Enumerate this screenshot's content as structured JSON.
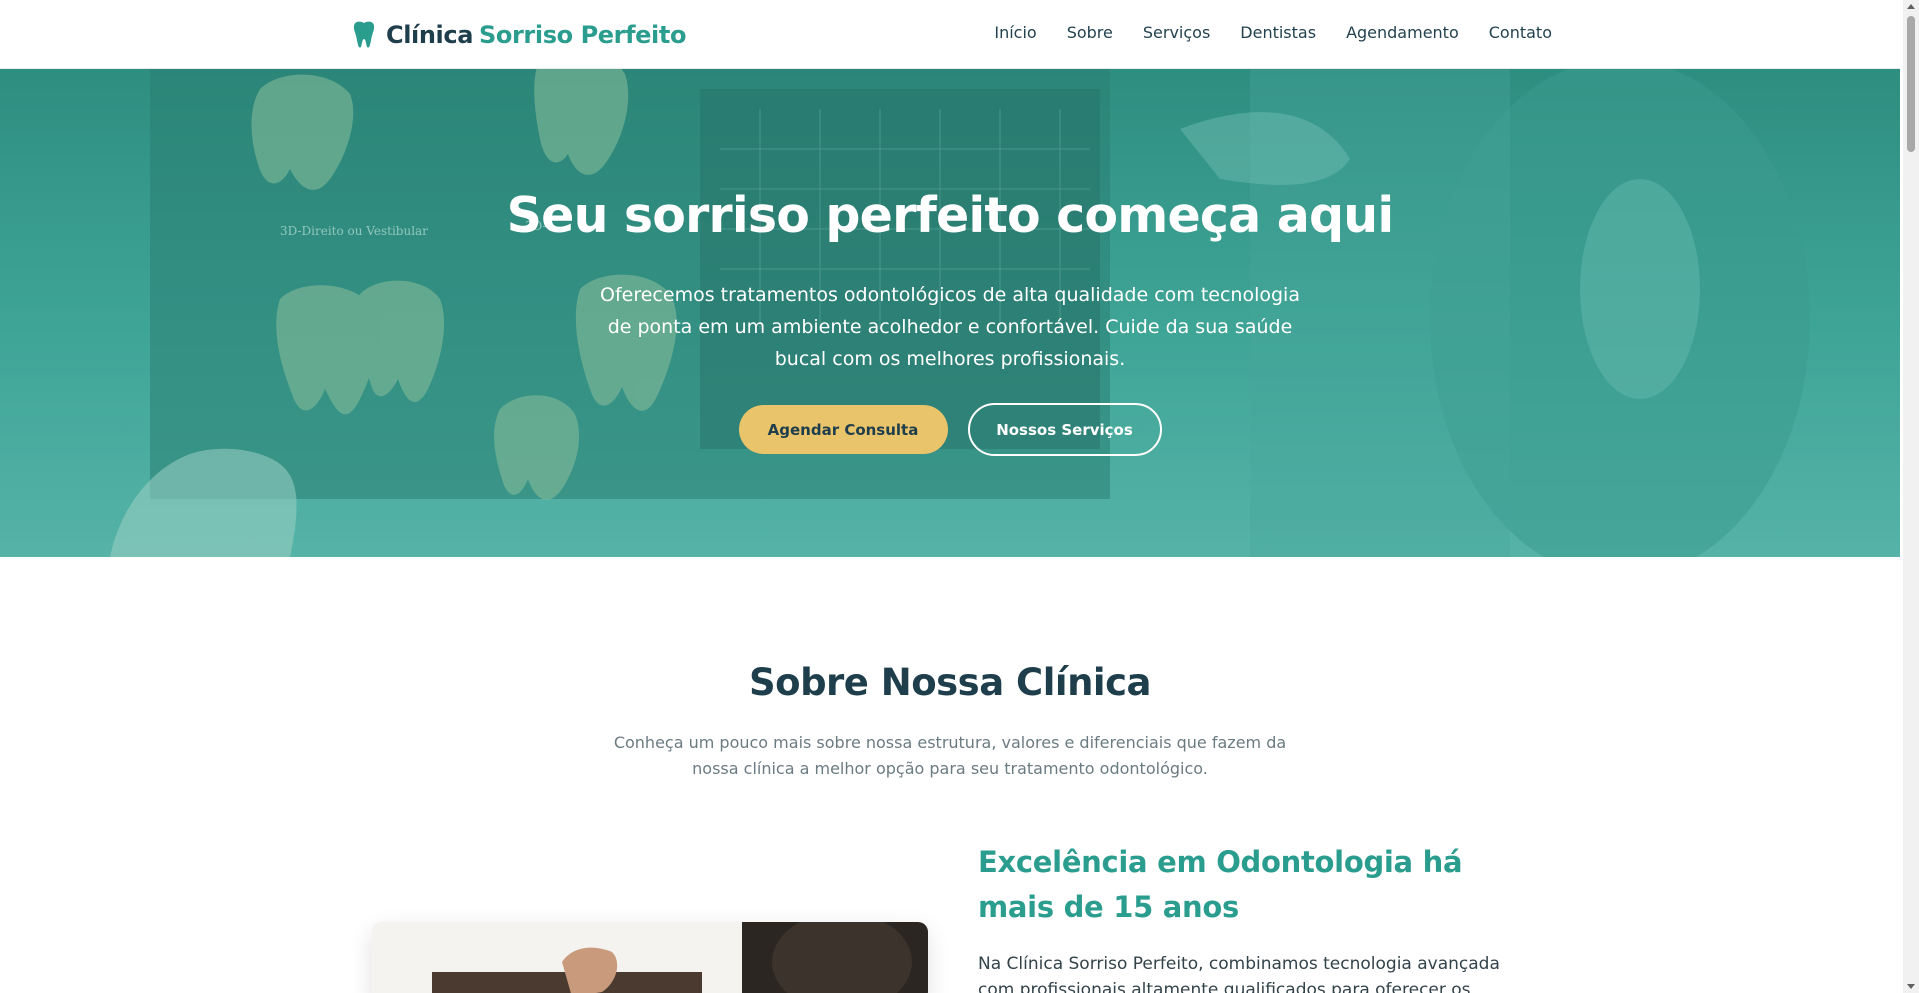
{
  "header": {
    "brand_main": "Clínica",
    "brand_accent": "Sorriso Perfeito",
    "nav": [
      "Início",
      "Sobre",
      "Serviços",
      "Dentistas",
      "Agendamento",
      "Contato"
    ]
  },
  "hero": {
    "title": "Seu sorriso perfeito começa aqui",
    "subtitle": "Oferecemos tratamentos odontológicos de alta qualidade com tecnologia de ponta em um ambiente acolhedor e confortável. Cuide da sua saúde bucal com os melhores profissionais.",
    "primary_button": "Agendar Consulta",
    "secondary_button": "Nossos Serviços",
    "image_label_1": "3D-Direito ou Vestibular",
    "image_label_2": "3D-"
  },
  "about": {
    "title": "Sobre Nossa Clínica",
    "subtitle": "Conheça um pouco mais sobre nossa estrutura, valores e diferenciais que fazem da nossa clínica a melhor opção para seu tratamento odontológico.",
    "heading": "Excelência em Odontologia há mais de 15 anos",
    "text": "Na Clínica Sorriso Perfeito, combinamos tecnologia avançada com profissionais altamente qualificados para oferecer os melhores"
  },
  "colors": {
    "primary": "#2a9d8f",
    "dark": "#1f3e4c",
    "accent": "#e9c46a"
  },
  "icons": {
    "brand": "tooth-icon"
  }
}
